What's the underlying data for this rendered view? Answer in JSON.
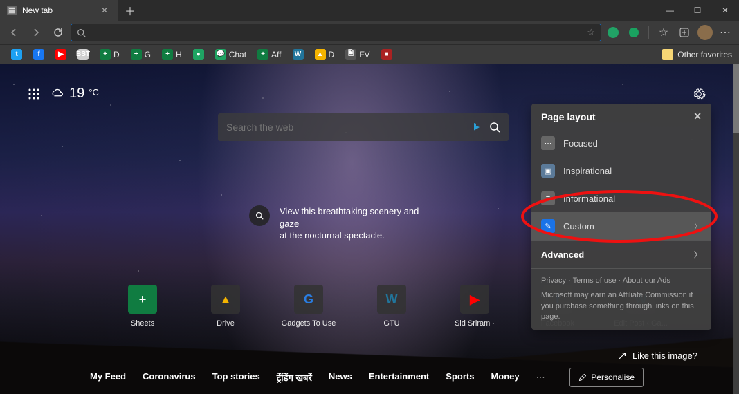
{
  "tab": {
    "title": "New tab"
  },
  "address_bar": {
    "placeholder": ""
  },
  "bookmarks": [
    {
      "label": "",
      "color": "#1DA1F2",
      "glyph": "t"
    },
    {
      "label": "",
      "color": "#1877F2",
      "glyph": "f"
    },
    {
      "label": "",
      "color": "#FF0000",
      "glyph": "▶"
    },
    {
      "label": "",
      "color": "#d0d0d0",
      "glyph": "BST"
    },
    {
      "label": "D",
      "color": "#107c41",
      "glyph": "+"
    },
    {
      "label": "G",
      "color": "#107c41",
      "glyph": "+"
    },
    {
      "label": "H",
      "color": "#107c41",
      "glyph": "+"
    },
    {
      "label": "",
      "color": "#1fa463",
      "glyph": "●"
    },
    {
      "label": "Chat",
      "color": "#1fa463",
      "glyph": "💬"
    },
    {
      "label": "Aff",
      "color": "#107c41",
      "glyph": "+"
    },
    {
      "label": "",
      "color": "#21759b",
      "glyph": "W"
    },
    {
      "label": "D",
      "color": "#f4b400",
      "glyph": "▲"
    },
    {
      "label": "FV",
      "color": "#555",
      "glyph": "🗎"
    },
    {
      "label": "",
      "color": "#aa2222",
      "glyph": "■"
    }
  ],
  "other_favorites": "Other favorites",
  "weather": {
    "temp": "19",
    "unit": "°C"
  },
  "web_search": {
    "placeholder": "Search the web"
  },
  "caption": {
    "line1": "View this breathtaking scenery and gaze",
    "line2": "at the nocturnal spectacle."
  },
  "tiles": [
    {
      "label": "Sheets",
      "bg": "#107c41",
      "glyph": "+"
    },
    {
      "label": "Drive",
      "bg": "#333",
      "glyph": "▲",
      "fg": "#f4b400"
    },
    {
      "label": "Gadgets To Use",
      "bg": "#333",
      "glyph": "G",
      "fg": "#2a7de1"
    },
    {
      "label": "GTU",
      "bg": "#333",
      "glyph": "W",
      "fg": "#21759b"
    },
    {
      "label": "Sid Sriram ·",
      "bg": "#333",
      "glyph": "▶",
      "fg": "#ff0000"
    },
    {
      "label": "Facebook",
      "bg": "#333",
      "glyph": "f",
      "fg": "#1877F2"
    },
    {
      "label": "Edit Post ‹ Ga...",
      "bg": "#333",
      "glyph": "W",
      "fg": "#21759b"
    }
  ],
  "like_image": "Like this image?",
  "feed_nav": [
    "My Feed",
    "Coronavirus",
    "Top stories",
    "ट्रेंडिंग खबरें",
    "News",
    "Entertainment",
    "Sports",
    "Money"
  ],
  "personalise": "Personalise",
  "panel": {
    "title": "Page layout",
    "items": [
      {
        "label": "Focused",
        "icon_bg": "#666",
        "glyph": "⋯"
      },
      {
        "label": "Inspirational",
        "icon_bg": "#5b7a99",
        "glyph": "▣"
      },
      {
        "label": "Informational",
        "icon_bg": "#666",
        "glyph": "≡"
      },
      {
        "label": "Custom",
        "icon_bg": "#1a73e8",
        "glyph": "✎",
        "selected": true,
        "chevron": true
      }
    ],
    "advanced": "Advanced",
    "footer_links": "Privacy · Terms of use · About our Ads",
    "footer_note": "Microsoft may earn an Affiliate Commission if you purchase something through links on this page."
  }
}
